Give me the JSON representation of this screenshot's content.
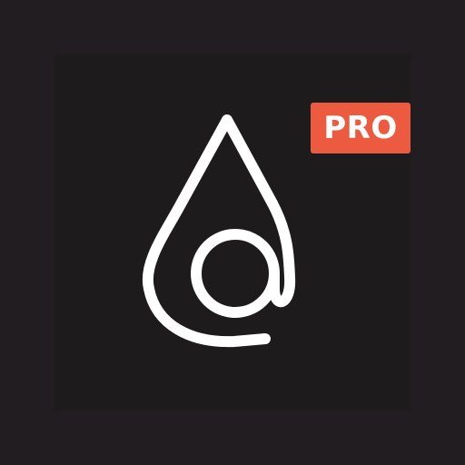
{
  "app_icon": {
    "badge": {
      "label": "PRO",
      "color": "#ec5a40",
      "text_color": "#ffffff"
    },
    "logo": {
      "icon": "water-drop-at-sign-icon",
      "stroke_color": "#ffffff"
    },
    "colors": {
      "outer_background": "#221d20",
      "tile_background": "#1e1b1c"
    }
  }
}
